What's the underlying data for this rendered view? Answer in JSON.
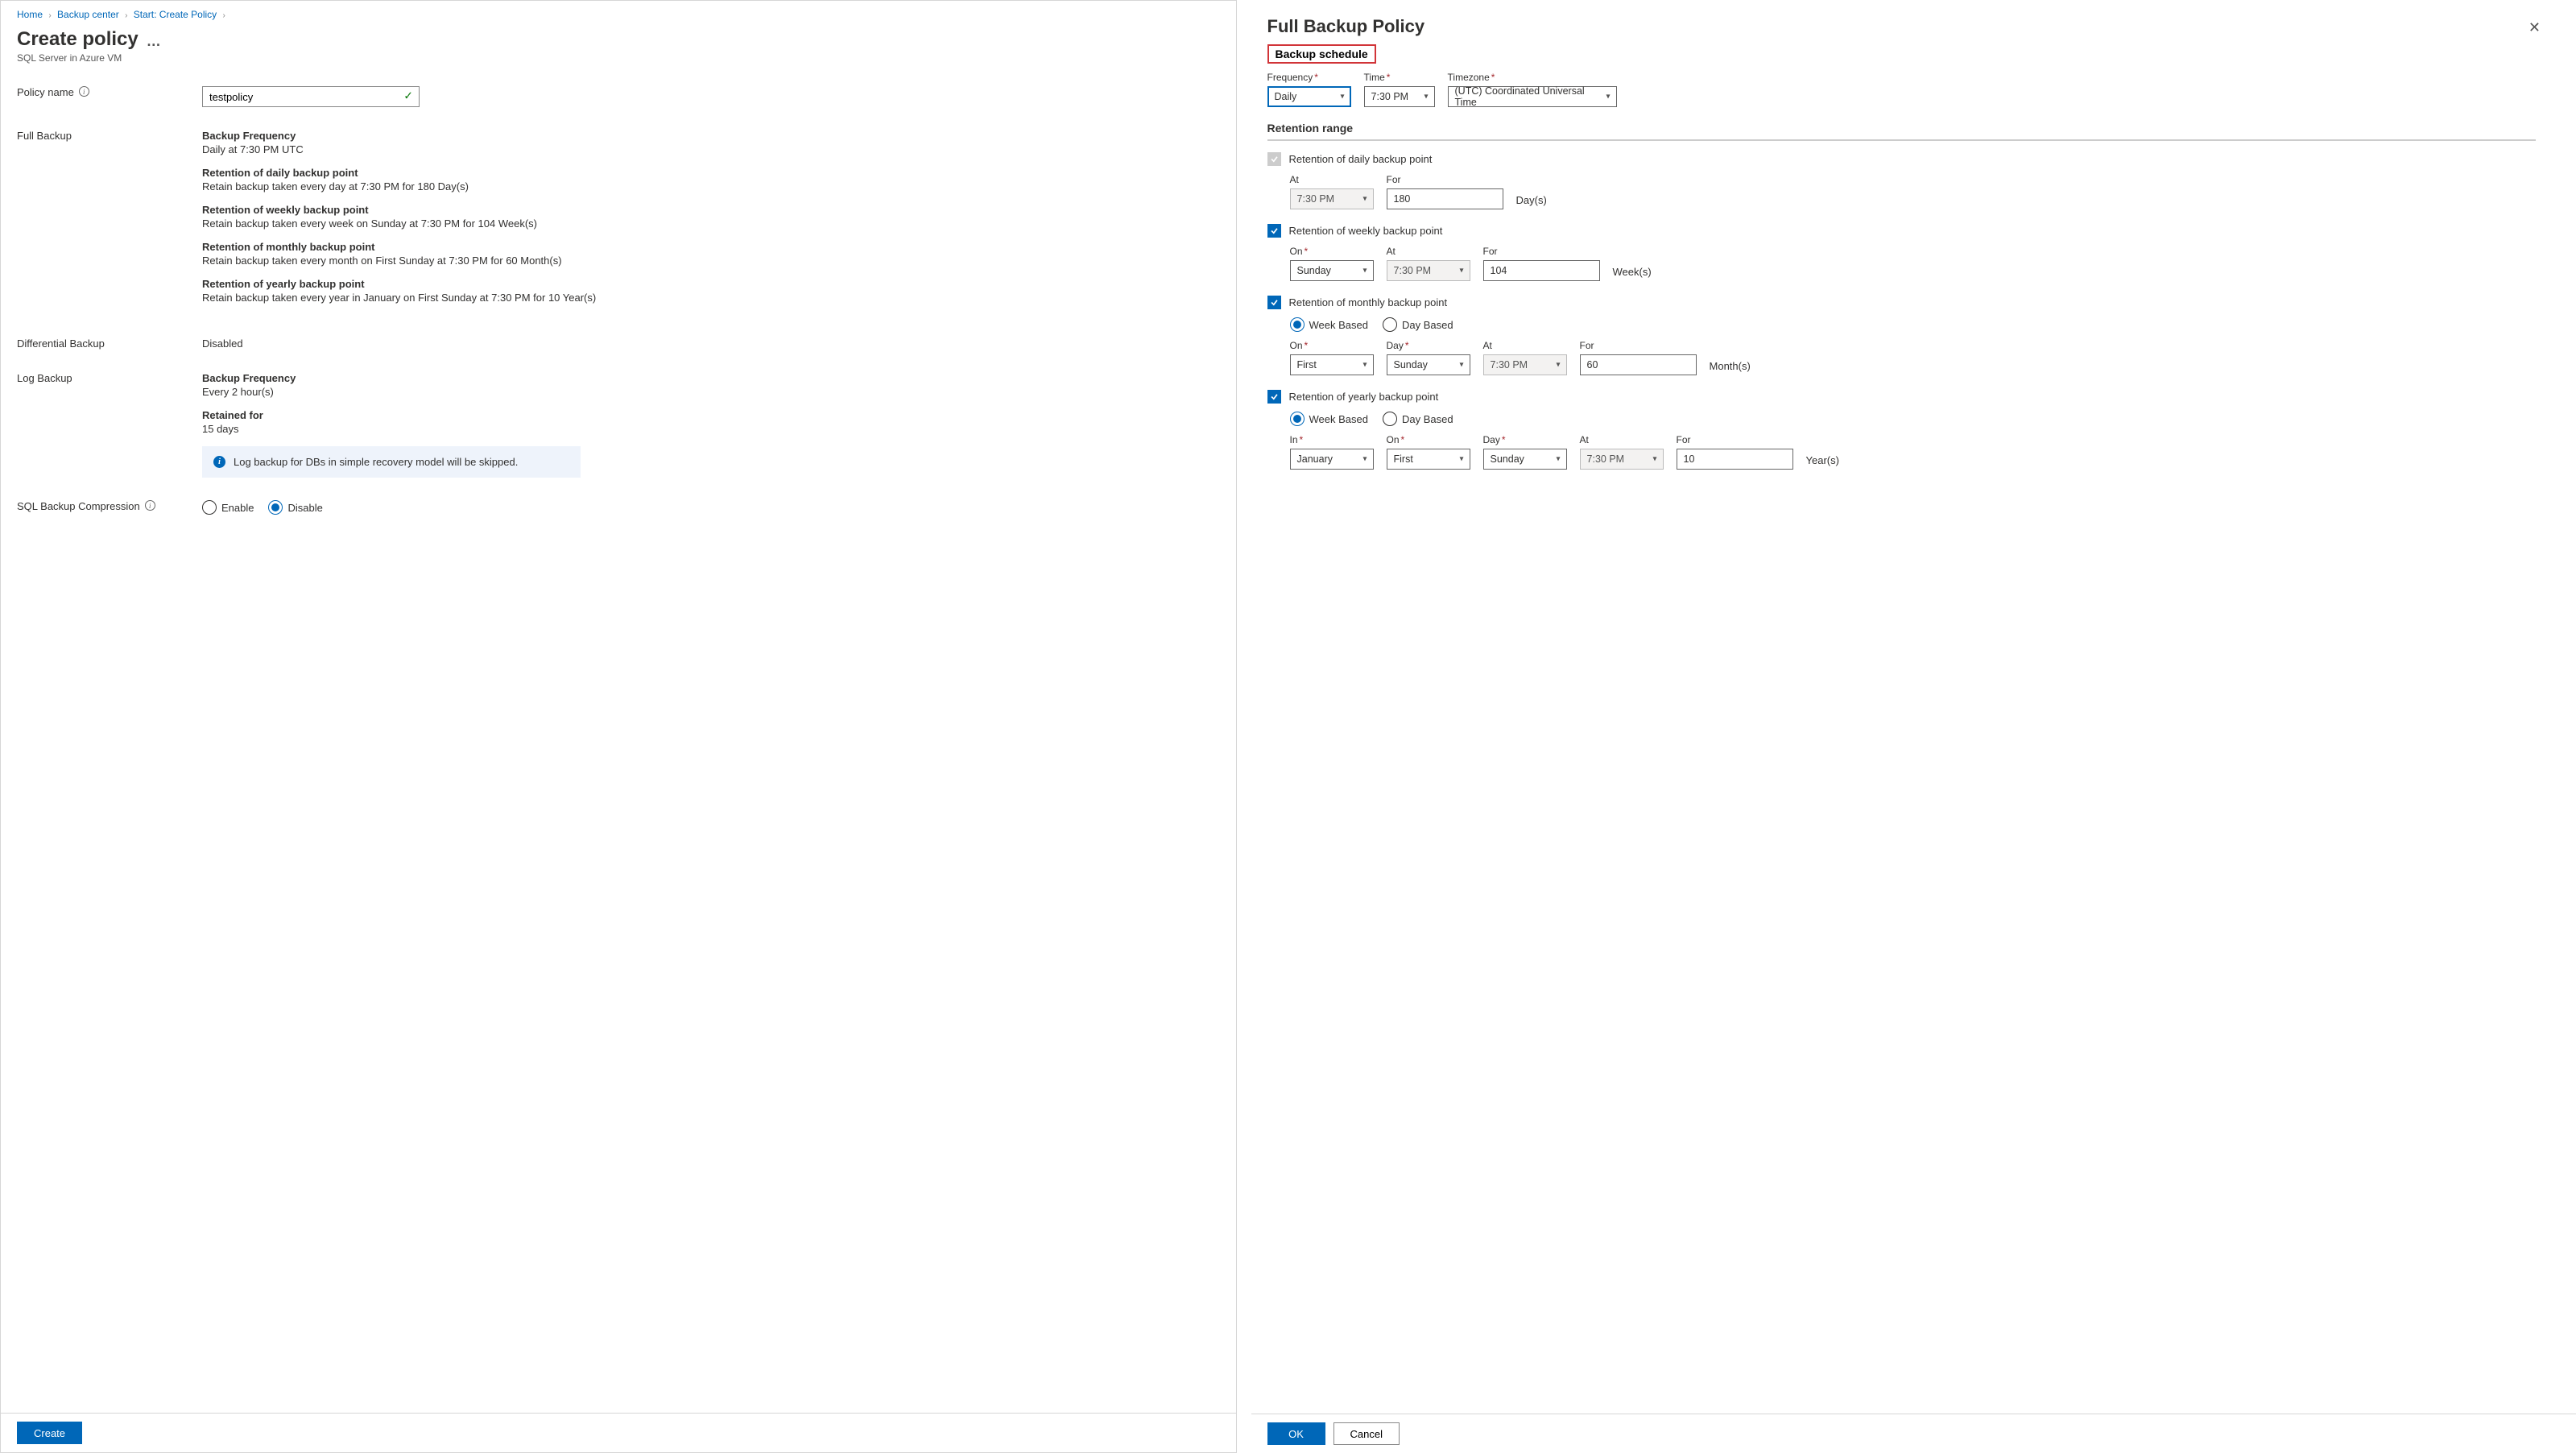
{
  "breadcrumb": {
    "home": "Home",
    "backup_center": "Backup center",
    "start": "Start: Create Policy"
  },
  "page": {
    "title": "Create policy",
    "subtitle": "SQL Server in Azure VM"
  },
  "policy_name": {
    "label": "Policy name",
    "value": "testpolicy"
  },
  "full_backup": {
    "label": "Full Backup",
    "freq_title": "Backup Frequency",
    "freq_value": "Daily at 7:30 PM UTC",
    "daily_title": "Retention of daily backup point",
    "daily_value": "Retain backup taken every day at 7:30 PM for 180 Day(s)",
    "weekly_title": "Retention of weekly backup point",
    "weekly_value": "Retain backup taken every week on Sunday at 7:30 PM for 104 Week(s)",
    "monthly_title": "Retention of monthly backup point",
    "monthly_value": "Retain backup taken every month on First Sunday at 7:30 PM for 60 Month(s)",
    "yearly_title": "Retention of yearly backup point",
    "yearly_value": "Retain backup taken every year in January on First Sunday at 7:30 PM for 10 Year(s)"
  },
  "diff_backup": {
    "label": "Differential Backup",
    "value": "Disabled"
  },
  "log_backup": {
    "label": "Log Backup",
    "freq_title": "Backup Frequency",
    "freq_value": "Every 2 hour(s)",
    "ret_title": "Retained for",
    "ret_value": "15 days",
    "info": "Log backup for DBs in simple recovery model will be skipped."
  },
  "compression": {
    "label": "SQL Backup Compression",
    "enable": "Enable",
    "disable": "Disable"
  },
  "buttons": {
    "create": "Create",
    "ok": "OK",
    "cancel": "Cancel"
  },
  "right": {
    "title": "Full Backup Policy",
    "schedule_header": "Backup schedule",
    "frequency_label": "Frequency",
    "frequency_value": "Daily",
    "time_label": "Time",
    "time_value": "7:30 PM",
    "timezone_label": "Timezone",
    "timezone_value": "(UTC) Coordinated Universal Time",
    "retention_header": "Retention range",
    "daily": {
      "label": "Retention of daily backup point",
      "at_label": "At",
      "at_value": "7:30 PM",
      "for_label": "For",
      "for_value": "180",
      "unit": "Day(s)"
    },
    "weekly": {
      "label": "Retention of weekly backup point",
      "on_label": "On",
      "on_value": "Sunday",
      "at_label": "At",
      "at_value": "7:30 PM",
      "for_label": "For",
      "for_value": "104",
      "unit": "Week(s)"
    },
    "monthly": {
      "label": "Retention of monthly backup point",
      "week_based": "Week Based",
      "day_based": "Day Based",
      "on_label": "On",
      "on_value": "First",
      "day_label": "Day",
      "day_value": "Sunday",
      "at_label": "At",
      "at_value": "7:30 PM",
      "for_label": "For",
      "for_value": "60",
      "unit": "Month(s)"
    },
    "yearly": {
      "label": "Retention of yearly backup point",
      "week_based": "Week Based",
      "day_based": "Day Based",
      "in_label": "In",
      "in_value": "January",
      "on_label": "On",
      "on_value": "First",
      "day_label": "Day",
      "day_value": "Sunday",
      "at_label": "At",
      "at_value": "7:30 PM",
      "for_label": "For",
      "for_value": "10",
      "unit": "Year(s)"
    }
  }
}
